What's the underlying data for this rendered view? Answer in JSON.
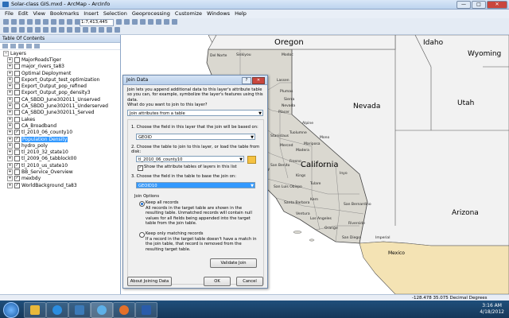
{
  "window": {
    "title": "Solar-class GIS.mxd - ArcMap - ArcInfo",
    "controls": [
      "—",
      "□",
      "✕"
    ]
  },
  "menu": [
    "File",
    "Edit",
    "View",
    "Bookmarks",
    "Insert",
    "Selection",
    "Geoprocessing",
    "Customize",
    "Windows",
    "Help"
  ],
  "toolbar": {
    "scale": "1:7,413,445"
  },
  "toc": {
    "title": "Table Of Contents",
    "root": "Layers",
    "layers": [
      {
        "label": "MajorRoadsTiger",
        "checked": false,
        "selected": false
      },
      {
        "label": "major_rivers_ta83",
        "checked": false,
        "selected": false
      },
      {
        "label": "Optimal Deployment",
        "checked": false,
        "selected": false
      },
      {
        "label": "Export_Output_test_optimization",
        "checked": false,
        "selected": false
      },
      {
        "label": "Export_Output_pop_refined",
        "checked": false,
        "selected": false
      },
      {
        "label": "Export_Output_pop_density3",
        "checked": false,
        "selected": false
      },
      {
        "label": "CA_SBDD_June302011_Unserved",
        "checked": false,
        "selected": false
      },
      {
        "label": "CA_SBDD_June302011_Underserved",
        "checked": false,
        "selected": false
      },
      {
        "label": "CA_SBDD_June302011_Served",
        "checked": false,
        "selected": false
      },
      {
        "label": "Lakes",
        "checked": false,
        "selected": false
      },
      {
        "label": "CA_Broadband",
        "checked": false,
        "selected": false
      },
      {
        "label": "tl_2010_06_county10",
        "checked": true,
        "selected": false
      },
      {
        "label": "Population Density",
        "checked": true,
        "selected": true
      },
      {
        "label": "hydro_poly",
        "checked": false,
        "selected": false
      },
      {
        "label": "tl_2010_32_state10",
        "checked": false,
        "selected": false
      },
      {
        "label": "tl_2009_06_tabblock00",
        "checked": false,
        "selected": false
      },
      {
        "label": "tl_2010_us_state10",
        "checked": true,
        "selected": false
      },
      {
        "label": "BB_Service_Overview",
        "checked": false,
        "selected": false
      },
      {
        "label": "mexbdy",
        "checked": true,
        "selected": false
      },
      {
        "label": "WorldBackground_ta83",
        "checked": true,
        "selected": false
      }
    ]
  },
  "map": {
    "state_labels": {
      "oregon": "Oregon",
      "idaho": "Idaho",
      "wyoming": "Wyoming",
      "nevada": "Nevada",
      "utah": "Utah",
      "california": "California",
      "arizona": "Arizona",
      "mexico": "Mexico"
    },
    "county_labels": [
      "Del Norte",
      "Siskiyou",
      "Modoc",
      "Humboldt",
      "Lassen",
      "Plumas",
      "Sierra",
      "Nevada",
      "Placer",
      "Alpine",
      "Mono",
      "Mariposa",
      "Madera",
      "Fresno",
      "Tulare",
      "Inyo",
      "Kings",
      "Kern",
      "San Luis Obispo",
      "Santa Barbara",
      "Ventura",
      "Los Angeles",
      "San Bernardino",
      "Riverside",
      "Orange",
      "San Diego",
      "Imperial",
      "Monterey",
      "San Benito",
      "Merced",
      "Stanislaus",
      "Tuolumne",
      "Mendocino"
    ],
    "colors": {
      "land": "#dad8d0",
      "ocean": "#ffffff",
      "us_state": "#f2f2f2",
      "mexico": "#f4e3b4",
      "boundary": "#4a4a4a"
    }
  },
  "dialog": {
    "title": "Join Data",
    "help": "?",
    "close": "✕",
    "intro": "Join lets you append additional data to this layer's attribute table so you can, for example, symbolize the layer's features using this data.",
    "what_label": "What do you want to join to this layer?",
    "join_type": "Join attributes from a table",
    "step1": "1.  Choose the field in this layer that the join will be based on:",
    "field1": "GEOID",
    "step2": "2.  Choose the table to join to this layer, or load the table from disk:",
    "table": "tl_2010_06_county10",
    "show_attr": "Show the attribute tables of layers in this list",
    "step3": "3.  Choose the field in the table to base the join on:",
    "field3": "GEOID10",
    "options_label": "Join Options",
    "keep_all": "Keep all records",
    "keep_all_desc": "All records in the target table are shown in the resulting table. Unmatched records will contain null values for all fields being appended into the target table from the join table.",
    "keep_match": "Keep only matching records",
    "keep_match_desc": "If a record in the target table doesn't have a match in the join table, that record is removed from the resulting target table.",
    "validate": "Validate Join",
    "about": "About Joining Data",
    "ok": "OK",
    "cancel": "Cancel"
  },
  "status": {
    "coords": "-128.478  35.075 Decimal Degrees"
  },
  "taskbar": {
    "time": "3:16 AM",
    "date": "4/18/2012"
  }
}
